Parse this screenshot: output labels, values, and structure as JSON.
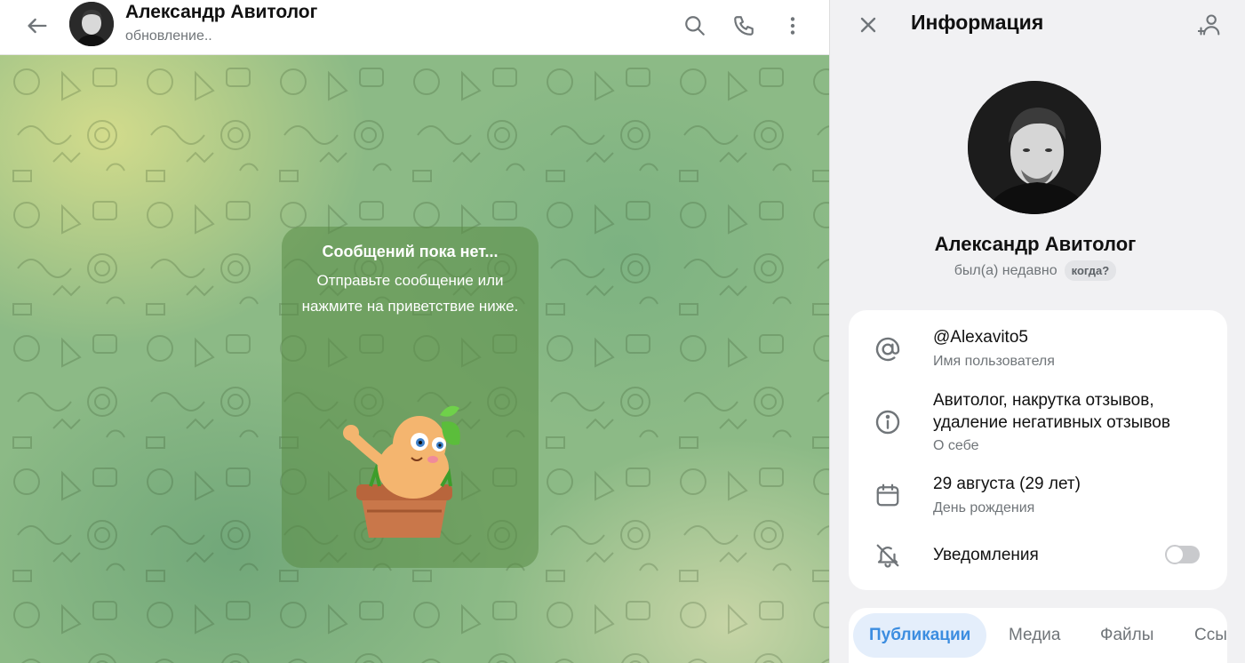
{
  "chat_header": {
    "contact_name": "Александр Авитолог",
    "status": "обновление.."
  },
  "empty_chat": {
    "title": "Сообщений пока нет...",
    "text": "Отправьте сообщение или нажмите на приветствие ниже."
  },
  "info_panel": {
    "title": "Информация",
    "profile_name": "Александр Авитолог",
    "last_seen": "был(а) недавно",
    "when_badge": "когда?",
    "username": {
      "value": "@Alexavito5",
      "label": "Имя пользователя"
    },
    "bio": {
      "line1": "Авитолог, накрутка отзывов,",
      "line2": "удаление негативных отзывов",
      "label": "О себе"
    },
    "birthday": {
      "value": "29 августа (29 лет)",
      "label": "День рождения"
    },
    "notifications": {
      "label": "Уведомления",
      "enabled": false
    },
    "tabs": [
      "Публикации",
      "Медиа",
      "Файлы",
      "Ссылки"
    ],
    "active_tab": "Публикации"
  },
  "icons": {
    "back": "arrow-left-icon",
    "search": "search-icon",
    "call": "phone-icon",
    "more": "more-vertical-icon",
    "close": "close-icon",
    "add_contact": "add-user-icon",
    "username": "at-sign-icon",
    "bio": "info-icon",
    "birthday": "calendar-icon",
    "notifications": "bell-off-icon"
  },
  "colors": {
    "accent": "#3c8de0",
    "muted_text": "#707579",
    "tab_active_bg": "#e4eefb",
    "card_bg": "#ffffff"
  }
}
